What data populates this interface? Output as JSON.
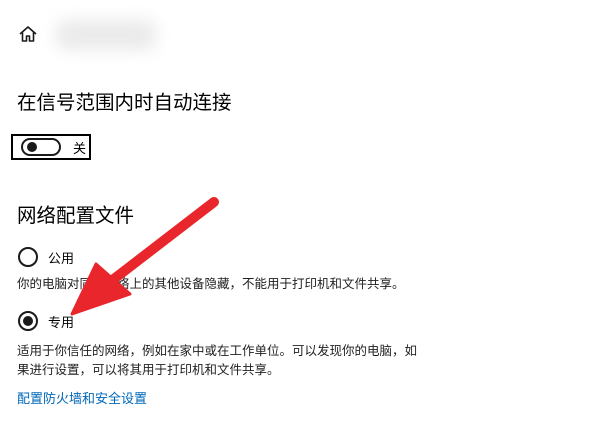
{
  "connect": {
    "heading": "在信号范围内时自动连接",
    "toggle_state": "关"
  },
  "profile": {
    "heading": "网络配置文件",
    "public_label": "公用",
    "public_desc": "你的电脑对同一网络上的其他设备隐藏，不能用于打印机和文件共享。",
    "private_label": "专用",
    "private_desc_line1": "适用于你信任的网络，例如在家中或在工作单位。可以发现你的电脑，如",
    "private_desc_line2": "果进行设置，可以将其用于打印机和文件共享。",
    "selected": "专用"
  },
  "firewall_link": "配置防火墙和安全设置",
  "colors": {
    "accent_link": "#0067b8",
    "arrow": "#e8262c"
  },
  "icons": {
    "home": "home-icon"
  }
}
